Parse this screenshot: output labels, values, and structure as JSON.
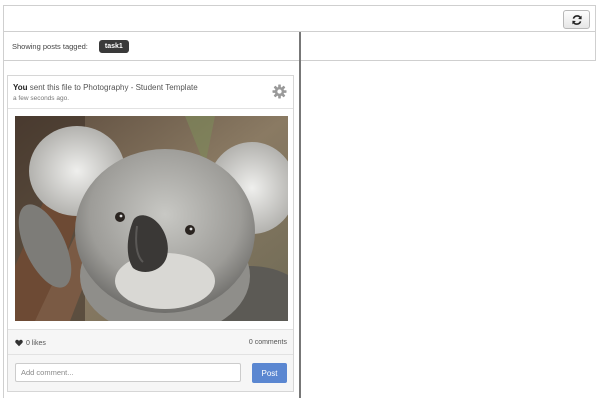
{
  "toolbar": {
    "refresh_icon": "refresh-icon"
  },
  "filter": {
    "label": "Showing posts tagged:",
    "tag": "task1"
  },
  "post": {
    "actor": "You",
    "action_text": " sent this file to Photography - Student Template",
    "timestamp": "a few seconds ago.",
    "settings_icon": "gear-icon",
    "image_subject": "koala-photo",
    "likes_label": "0 likes",
    "comments_label": "0 comments",
    "comment_placeholder": "Add comment...",
    "post_button": "Post"
  },
  "colors": {
    "post_button": "#5b87d1",
    "tag_chip": "#3a3a3a"
  }
}
